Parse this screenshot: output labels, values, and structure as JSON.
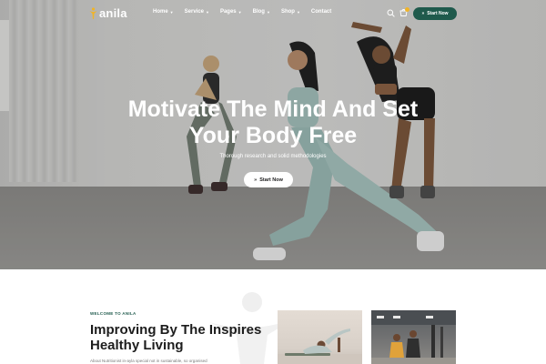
{
  "brand": {
    "name": "anila"
  },
  "nav": {
    "items": [
      {
        "label": "Home",
        "dropdown": true
      },
      {
        "label": "Service",
        "dropdown": true
      },
      {
        "label": "Pages",
        "dropdown": true
      },
      {
        "label": "Blog",
        "dropdown": true
      },
      {
        "label": "Shop",
        "dropdown": true
      },
      {
        "label": "Contact",
        "dropdown": false
      }
    ],
    "cta_label": "Start Now"
  },
  "hero": {
    "title": "Motivate The Mind And Set Your Body Free",
    "subtitle": "Thorough research and solid methodologies",
    "button_label": "Start Now"
  },
  "about": {
    "eyebrow": "WELCOME TO ANILA",
    "title": "Improving By The Inspires Healthy Living",
    "text": "About Nutritionist in-ayla special not in sustainable, so organised"
  },
  "colors": {
    "accent": "#1f5a4c",
    "badge": "#f0b429",
    "hero_text": "#ffffff"
  },
  "icons": [
    "logo-mark-icon",
    "chevron-down-icon",
    "search-icon",
    "cart-icon",
    "double-chevron-icon",
    "yoga-watermark-icon"
  ]
}
